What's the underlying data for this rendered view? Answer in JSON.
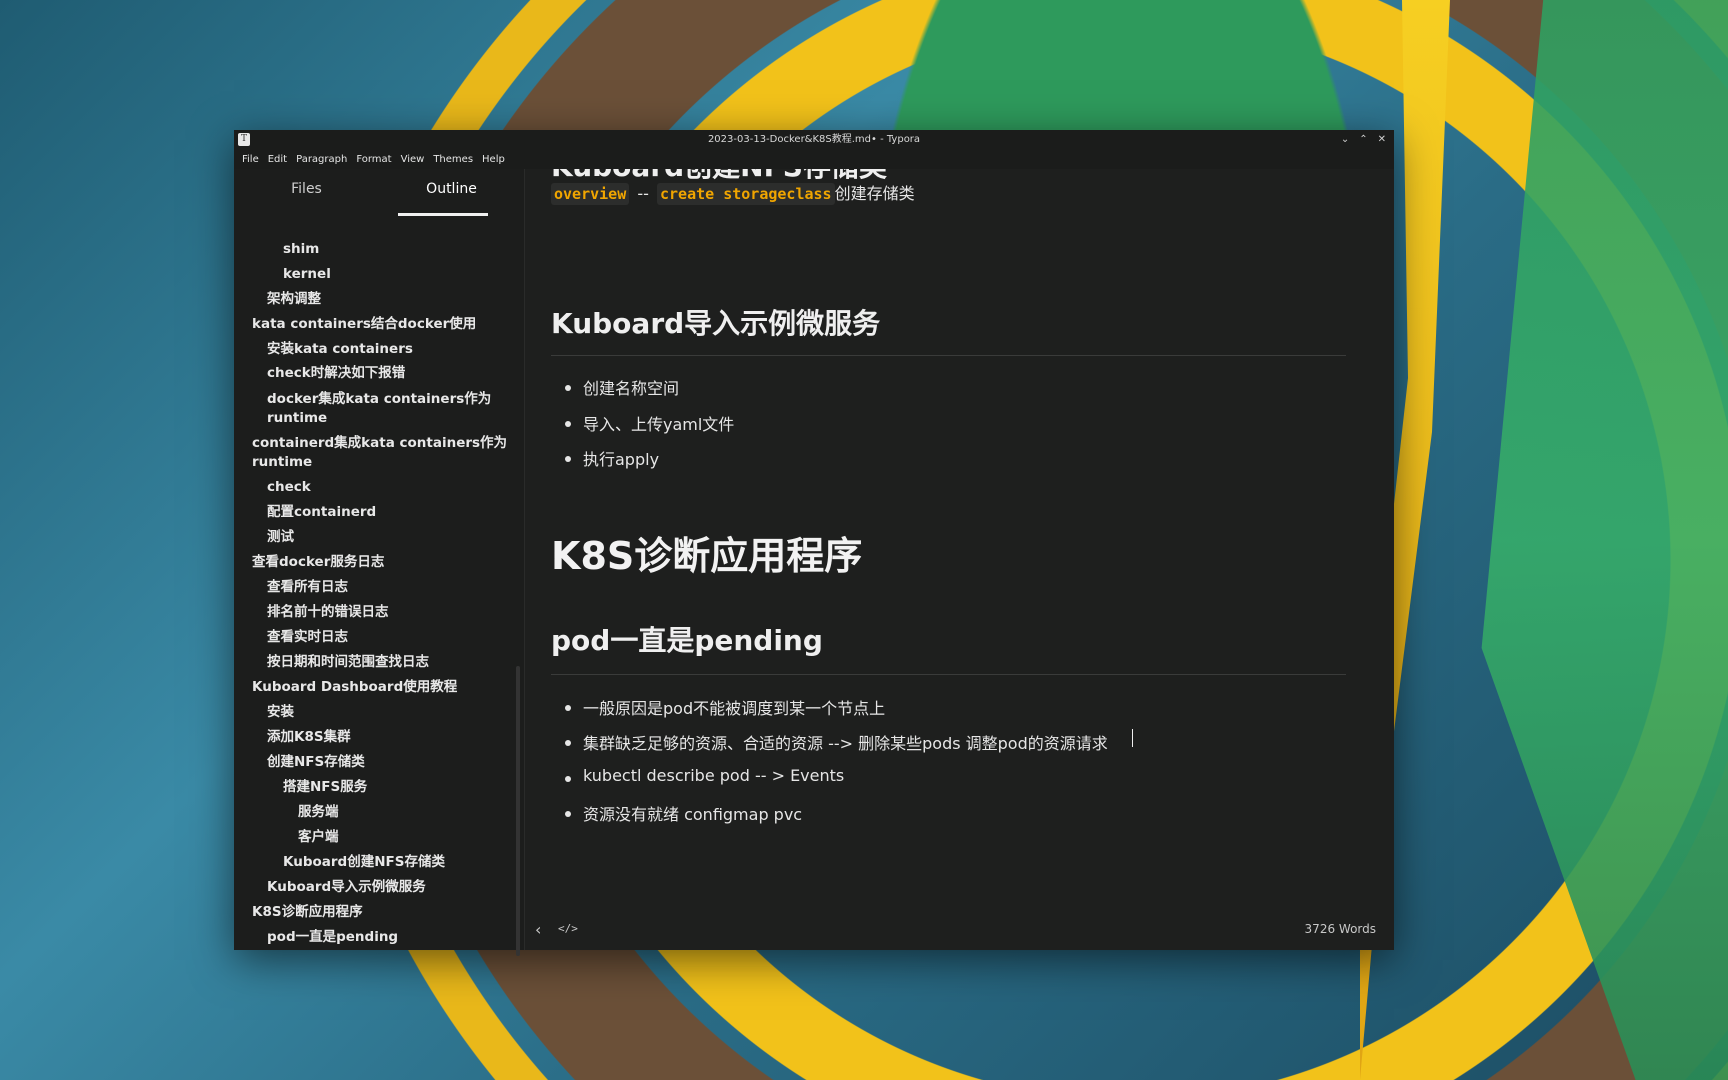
{
  "window": {
    "title": "2023-03-13-Docker&K8S教程.md• - Typora",
    "app_icon": "T",
    "controls": [
      "⌄",
      "⌃",
      "✕"
    ]
  },
  "menu": [
    "File",
    "Edit",
    "Paragraph",
    "Format",
    "View",
    "Themes",
    "Help"
  ],
  "sidebar": {
    "tabs": [
      "Files",
      "Outline"
    ],
    "active_tab": "Outline",
    "outline": [
      {
        "label": "shim",
        "level": 3
      },
      {
        "label": "kernel",
        "level": 3
      },
      {
        "label": "架构调整",
        "level": 2
      },
      {
        "label": "kata containers结合docker使用",
        "level": 1
      },
      {
        "label": "安装kata containers",
        "level": 2
      },
      {
        "label": "check时解决如下报错",
        "level": 2
      },
      {
        "label": "docker集成kata containers作为",
        "level": 2
      },
      {
        "label": "runtime",
        "level": 2
      },
      {
        "label": "containerd集成kata containers作为",
        "level": 1
      },
      {
        "label": "runtime",
        "level": 1
      },
      {
        "label": "check",
        "level": 2
      },
      {
        "label": "配置containerd",
        "level": 2
      },
      {
        "label": "测试",
        "level": 2
      },
      {
        "label": "查看docker服务日志",
        "level": 1
      },
      {
        "label": "查看所有日志",
        "level": 2
      },
      {
        "label": "排名前十的错误日志",
        "level": 2
      },
      {
        "label": "查看实时日志",
        "level": 2
      },
      {
        "label": "按日期和时间范围查找日志",
        "level": 2
      },
      {
        "label": "Kuboard Dashboard使用教程",
        "level": 1
      },
      {
        "label": "安装",
        "level": 2
      },
      {
        "label": "添加K8S集群",
        "level": 2
      },
      {
        "label": "创建NFS存储类",
        "level": 2
      },
      {
        "label": "搭建NFS服务",
        "level": 3
      },
      {
        "label": "服务端",
        "level": 4
      },
      {
        "label": "客户端",
        "level": 4
      },
      {
        "label": "Kuboard创建NFS存储类",
        "level": 3
      },
      {
        "label": "Kuboard导入示例微服务",
        "level": 2
      },
      {
        "label": "K8S诊断应用程序",
        "level": 1
      },
      {
        "label": "pod一直是pending",
        "level": 2
      }
    ]
  },
  "editor": {
    "partial_heading": "Kuboard创建NFS存储类",
    "storageclass_line": {
      "code1": "overview",
      "sep": "--",
      "code2": "create storageclass",
      "text": "创建存储类"
    },
    "h2_microservice": "Kuboard导入示例微服务",
    "list1": [
      "创建名称空间",
      "导入、上传yaml文件",
      "执行apply"
    ],
    "h1_diagnose": "K8S诊断应用程序",
    "h2_pending": "pod一直是pending",
    "list2": [
      "一般原因是pod不能被调度到某一个节点上",
      "集群缺乏足够的资源、合适的资源 --> 删除某些pods  调整pod的资源请求",
      "kubectl describe pod -- > Events",
      "资源没有就绪 configmap pvc"
    ]
  },
  "statusbar": {
    "back_icon": "‹",
    "source_icon": "</>",
    "word_count": "3726 Words"
  }
}
